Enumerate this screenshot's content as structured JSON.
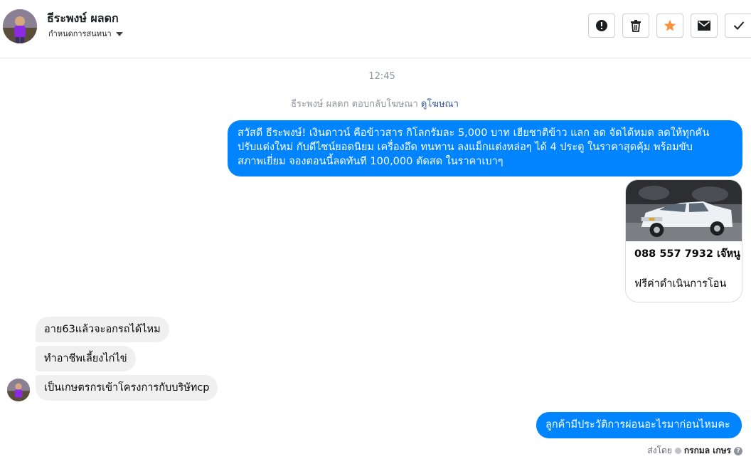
{
  "header": {
    "name": "ธีระพงษ์ ผลดก",
    "subtitle": "กำหนดการสนทนา"
  },
  "toolbar": {
    "buttons": [
      {
        "icon": "alert-icon"
      },
      {
        "icon": "trash-icon"
      },
      {
        "icon": "star-icon",
        "color": "#f7923b"
      },
      {
        "icon": "mail-icon"
      },
      {
        "icon": "check-icon"
      }
    ]
  },
  "conversation": {
    "timestamp": "12:45",
    "ad_notice": "ธีระพงษ์ ผลดก ตอบกลับโฆษณา",
    "ad_link": "ดูโฆษณา",
    "ad_message_lines": [
      "สวัสดี ธีระพงษ์! เงินดาวน์ คือข้าวสาร กิโลกรัมละ 5,000 บาท เฮียชาติข้าว แลก ลด จัดได้หมด ลดให้ทุกคัน",
      "ปรับแต่งใหม่ กับดีไซน์ยอดนิยม เครื่องอึด ทนทาน ลงแม็กแต่งหล่อๆ ได้ 4 ประตู ในราคาสุดคุ้ม พร้อมขับ",
      "สภาพเยี่ยม จองตอนนี้ลดทันที 100,000 ตัดสด ในราคาเบาๆ"
    ],
    "card": {
      "title": "088 557 7932 เจ๊หนู",
      "description": "ฟรีค่าดำเนินการโอน"
    },
    "incoming": [
      "อาย63แล้วจะอกรถได้ไหม",
      "ทำอาชีพเลี้ยงไก่ไข่",
      "เป็นเกษตรกรเข้าโครงการกับบริษัทcp"
    ],
    "reply": "ลูกค้ามีประวัติการผ่อนอะไรมาก่อนไหมคะ",
    "sent_by_label": "ส่งโดย",
    "sent_by_name": "กรกมล เกษร"
  },
  "colors": {
    "outgoing_bubble": "#0084ff",
    "incoming_bubble": "#f1f0f0",
    "link": "#365899"
  }
}
